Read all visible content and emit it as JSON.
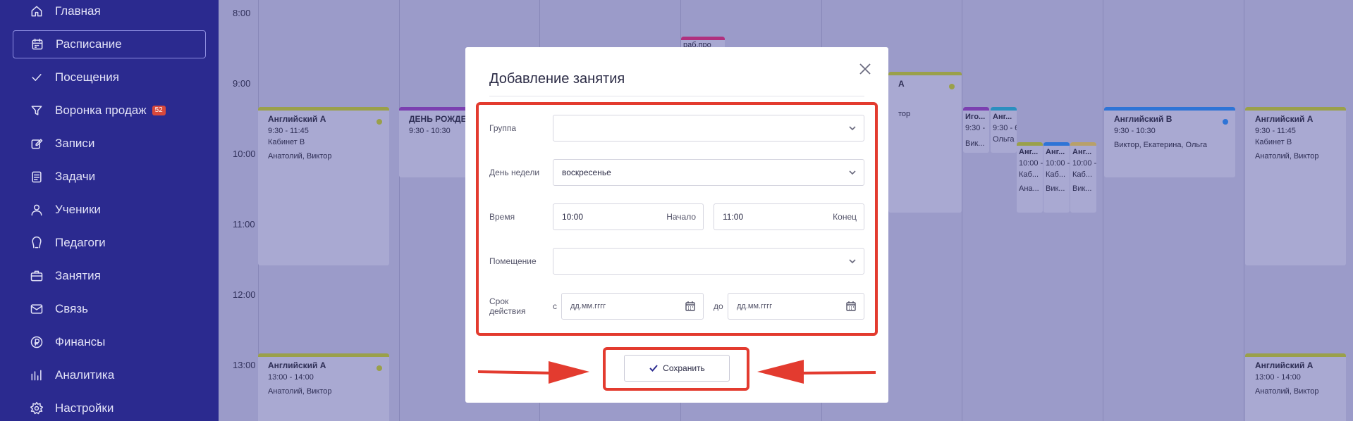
{
  "sidebar": {
    "items": [
      {
        "label": "Главная",
        "icon": "home-icon"
      },
      {
        "label": "Расписание",
        "icon": "calendar-icon",
        "active": true
      },
      {
        "label": "Посещения",
        "icon": "check-icon"
      },
      {
        "label": "Воронка продаж",
        "icon": "funnel-icon",
        "badge": "52"
      },
      {
        "label": "Записи",
        "icon": "edit-icon"
      },
      {
        "label": "Задачи",
        "icon": "tasks-icon"
      },
      {
        "label": "Ученики",
        "icon": "user-icon"
      },
      {
        "label": "Педагоги",
        "icon": "teacher-icon"
      },
      {
        "label": "Занятия",
        "icon": "briefcase-icon"
      },
      {
        "label": "Связь",
        "icon": "mail-icon"
      },
      {
        "label": "Финансы",
        "icon": "coin-icon"
      },
      {
        "label": "Аналитика",
        "icon": "analytics-icon"
      },
      {
        "label": "Настройки",
        "icon": "gear-icon"
      }
    ]
  },
  "calendar": {
    "times": [
      "8:00",
      "9:00",
      "10:00",
      "11:00",
      "12:00",
      "13:00"
    ],
    "events": {
      "e1": {
        "title": "Английский А",
        "time": "9:30 - 11:45",
        "room": "Кабинет В",
        "people": "Анатолий, Виктор"
      },
      "e2": {
        "title": "ДЕНЬ РОЖДЕ",
        "time": "9:30 - 10:30"
      },
      "e3": {
        "title": "раб.про"
      },
      "e4": {
        "title": "А",
        "people": "тор"
      },
      "e5": {
        "title": "Иго...",
        "time": "9:30 -",
        "people": "Вик..."
      },
      "e6": {
        "title": "Анг...",
        "time": "9:30 - 6",
        "people": "Ольга"
      },
      "e7": {
        "title": "Анг...",
        "time": "10:00 -",
        "room": "Каб...",
        "people": "Ана..."
      },
      "e8": {
        "title": "Анг...",
        "time": "10:00 -",
        "room": "Каб...",
        "people": "Вик..."
      },
      "e9": {
        "title": "Анг...",
        "time": "10:00 -",
        "room": "Каб...",
        "people": "Вик..."
      },
      "e10": {
        "title": "Английский В",
        "time": "9:30 - 10:30",
        "people": "Виктор, Екатерина, Ольга"
      },
      "e11": {
        "title": "Английский А",
        "time": "9:30 - 11:45",
        "room": "Кабинет В",
        "people": "Анатолий, Виктор"
      },
      "e12": {
        "title": "Английский А",
        "time": "13:00 - 14:00",
        "people": "Анатолий, Виктор"
      },
      "e13": {
        "title": "Английский А",
        "time": "13:00 - 14:00",
        "people": "Анатолий, Виктор"
      }
    }
  },
  "modal": {
    "title": "Добавление занятия",
    "group_label": "Группа",
    "group_value": "",
    "weekday_label": "День недели",
    "weekday_value": "воскресенье",
    "time_label": "Время",
    "start_value": "10:00",
    "start_suffix": "Начало",
    "end_value": "11:00",
    "end_suffix": "Конец",
    "room_label": "Помещение",
    "room_value": "",
    "period_label_1": "Срок",
    "period_label_2": "действия",
    "from_label": "с",
    "to_label": "до",
    "date_placeholder": "дд.мм.гггг",
    "save_label": "Сохранить"
  },
  "colors": {
    "sidebar_bg": "#2b2a8f",
    "highlight": "#e33b2f",
    "event_olive": "#9aa04a",
    "event_purple": "#7b3fb0",
    "event_magenta": "#b0307e",
    "event_blue": "#2e74d6",
    "event_teal": "#2b8fbf"
  }
}
